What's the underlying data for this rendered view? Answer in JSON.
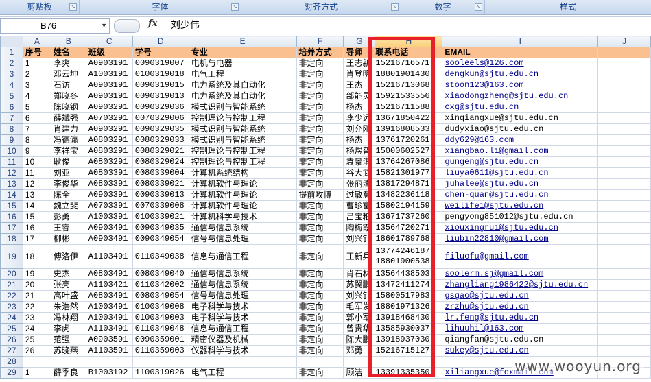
{
  "ribbon": {
    "groups": [
      {
        "label": "剪贴板"
      },
      {
        "label": "字体"
      },
      {
        "label": "对齐方式"
      },
      {
        "label": "数字"
      },
      {
        "label": "样式"
      }
    ]
  },
  "formula_bar": {
    "name_box": "B76",
    "fx": "fx",
    "content": "刘少伟"
  },
  "sheet": {
    "columns": [
      "A",
      "B",
      "C",
      "D",
      "E",
      "F",
      "G",
      "H",
      "I",
      "J"
    ],
    "header_row": {
      "row": "1",
      "cells": [
        "序号",
        "姓名",
        "班级",
        "学号",
        "专业",
        "培养方式",
        "导师",
        "联系电话",
        "EMAIL",
        ""
      ]
    },
    "rows": [
      {
        "row": "2",
        "cells": [
          "1",
          "李爽",
          "A0903191",
          "0090319007",
          "电机与电器",
          "非定向",
          "王志新",
          "15216716571",
          "sooleels@126.com",
          ""
        ]
      },
      {
        "row": "3",
        "cells": [
          "2",
          "邓云坤",
          "A1003191",
          "0100319018",
          "电气工程",
          "非定向",
          "肖登明",
          "18801901430",
          "dengkun@sjtu.edu.cn",
          ""
        ]
      },
      {
        "row": "4",
        "cells": [
          "3",
          "石访",
          "A0903191",
          "0090319015",
          "电力系统及其自动化",
          "非定向",
          "王杰",
          "15216713068",
          "stoon123@163.com",
          ""
        ]
      },
      {
        "row": "5",
        "cells": [
          "4",
          "郑晓冬",
          "A0903191",
          "0090319013",
          "电力系统及其自动化",
          "非定向",
          "邰能灵",
          "15921533556",
          "xiaodongzheng@sjtu.edu.cn",
          ""
        ]
      },
      {
        "row": "6",
        "cells": [
          "5",
          "陈晓钢",
          "A0903291",
          "0090329036",
          "模式识别与智能系统",
          "非定向",
          "杨杰",
          "15216711588",
          "cxg@sjtu.edu.cn",
          ""
        ]
      },
      {
        "row": "7",
        "cells": [
          "6",
          "薛斌强",
          "A0703291",
          "0070329006",
          "控制理论与控制工程",
          "非定向",
          "李少远",
          "13671850422",
          "xinqiangxue@sjtu.edu.cn",
          ""
        ]
      },
      {
        "row": "8",
        "cells": [
          "7",
          "肖建力",
          "A0903291",
          "0090329035",
          "模式识别与智能系统",
          "非定向",
          "刘允刚",
          "13916808533",
          "dudyxiao@sjtu.edu.cn",
          ""
        ]
      },
      {
        "row": "9",
        "cells": [
          "8",
          "冯德瀛",
          "A0803291",
          "0080329033",
          "模式识别与智能系统",
          "非定向",
          "杨杰",
          "13761720261",
          "ddy629@163.com",
          ""
        ]
      },
      {
        "row": "10",
        "cells": [
          "9",
          "李祥宝",
          "A0803291",
          "0080329021",
          "控制理论与控制工程",
          "非定向",
          "杨煜普",
          "15000602527",
          "xiangbao.li@gmail.com",
          ""
        ]
      },
      {
        "row": "11",
        "cells": [
          "10",
          "耿俊",
          "A0803291",
          "0080329024",
          "控制理论与控制工程",
          "非定向",
          "袁景淇",
          "13764267086",
          "gungeng@sjtu.edu.cn",
          ""
        ]
      },
      {
        "row": "12",
        "cells": [
          "11",
          "刘亚",
          "A0803391",
          "0080339004",
          "计算机系统结构",
          "非定向",
          "谷大武",
          "15821301977",
          "liuya0611@sjtu.edu.cn",
          ""
        ]
      },
      {
        "row": "13",
        "cells": [
          "12",
          "李俊华",
          "A0803391",
          "0080339021",
          "计算机软件与理论",
          "非定向",
          "张丽清",
          "13817294871",
          "juhalee@sjtu.edu.cn",
          ""
        ]
      },
      {
        "row": "14",
        "cells": [
          "13",
          "陈全",
          "A0903391",
          "0090339013",
          "计算机软件与理论",
          "提前攻博",
          "过敏意",
          "13482236118",
          "chen-quan@sjtu.edu.cn",
          ""
        ]
      },
      {
        "row": "15",
        "cells": [
          "14",
          "魏立斐",
          "A0703391",
          "0070339008",
          "计算机软件与理论",
          "非定向",
          "曹珍富",
          "15802194159",
          "weilifei@sjtu.edu.cn",
          ""
        ]
      },
      {
        "row": "16",
        "cells": [
          "15",
          "彭勇",
          "A1003391",
          "0100339021",
          "计算机科学与技术",
          "非定向",
          "吕宝粮",
          "13671737260",
          "pengyong851012@sjtu.edu.cn",
          ""
        ]
      },
      {
        "row": "17",
        "cells": [
          "16",
          "王睿",
          "A0903491",
          "0090349035",
          "通信与信息系统",
          "非定向",
          "陶梅霞",
          "13564720271",
          "xiouxingrui@sjtu.edu.cn",
          ""
        ]
      },
      {
        "row": "18",
        "cells": [
          "17",
          "柳彬",
          "A0903491",
          "0090349054",
          "信号与信息处理",
          "非定向",
          "刘兴钊",
          "18601789768",
          "liubin22810@gmail.com",
          ""
        ]
      },
      {
        "row": "19",
        "cells": [
          "18",
          "傅洛伊",
          "A1103491",
          "0110349038",
          "信息与通信工程",
          "非定向",
          "王新兵",
          "13774246187\n18801900538",
          "filuofu@gmail.com",
          ""
        ]
      },
      {
        "row": "20",
        "cells": [
          "19",
          "史杰",
          "A0803491",
          "0080349040",
          "通信与信息系统",
          "非定向",
          "肖石林",
          "13564438503",
          "soolerm.sj@gmail.com",
          ""
        ]
      },
      {
        "row": "21",
        "cells": [
          "20",
          "张亮",
          "A1103421",
          "0110342002",
          "通信与信息系统",
          "非定向",
          "苏翼鹏",
          "13472411274",
          "zhangliang1986422@sjtu.edu.cn",
          ""
        ]
      },
      {
        "row": "22",
        "cells": [
          "21",
          "高叶盛",
          "A0803491",
          "0080349054",
          "信号与信息处理",
          "非定向",
          "刘兴钊",
          "15800517983",
          "gsgao@sjtu.edu.cn",
          ""
        ]
      },
      {
        "row": "23",
        "cells": [
          "22",
          "朱浩然",
          "A1003491",
          "0100349008",
          "电子科学与技术",
          "非定向",
          "毛军发",
          "18801971326",
          "zrzhu@sjtu.edu.cn",
          ""
        ]
      },
      {
        "row": "24",
        "cells": [
          "23",
          "冯林翔",
          "A1003491",
          "0100349003",
          "电子科学与技术",
          "非定向",
          "郭小军",
          "13918468430",
          "lr.feng@sjtu.edu.cn",
          ""
        ]
      },
      {
        "row": "25",
        "cells": [
          "24",
          "李虎",
          "A1103491",
          "0110349048",
          "信息与通信工程",
          "非定向",
          "曾贵华",
          "13585930037",
          "lihuuhil@163.com",
          ""
        ]
      },
      {
        "row": "26",
        "cells": [
          "25",
          "范强",
          "A0903591",
          "0090359001",
          "精密仪器及机械",
          "非定向",
          "陈大鹏",
          "13918937030",
          "qiangfan@sjtu.edu.cn",
          ""
        ]
      },
      {
        "row": "27",
        "cells": [
          "26",
          "苏晓燕",
          "A1103591",
          "0110359003",
          "仪器科学与技术",
          "非定向",
          "邓勇",
          "15216715127",
          "sukey@sjtu.edu.cn",
          ""
        ]
      },
      {
        "row": "28",
        "cells": [
          "",
          "",
          "",
          "",
          "",
          "",
          "",
          "",
          "",
          ""
        ]
      },
      {
        "row": "29",
        "cells": [
          "1",
          "薛季良",
          "B1003192",
          "1100319026",
          "电气工程",
          "非定向",
          "顾洁",
          "13391335350",
          "xiliangxue@foxmail.com",
          ""
        ]
      }
    ]
  },
  "highlight": {
    "column": "H",
    "color": "#e8202a"
  },
  "watermark": "www.wooyun.org"
}
